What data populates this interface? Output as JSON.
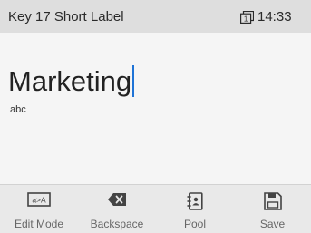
{
  "header": {
    "title": "Key 17 Short Label",
    "line_indicator": "1",
    "time": "14:33"
  },
  "editor": {
    "value": "Marketing",
    "input_mode": "abc"
  },
  "softkeys": [
    {
      "label": "Edit Mode",
      "icon": "edit-mode-icon",
      "icon_text": "a>A"
    },
    {
      "label": "Backspace",
      "icon": "backspace-icon"
    },
    {
      "label": "Pool",
      "icon": "pool-icon"
    },
    {
      "label": "Save",
      "icon": "save-icon"
    }
  ],
  "colors": {
    "caret": "#1e73d6",
    "header_bg": "#dedede",
    "softkey_bg": "#e9e9e9"
  }
}
